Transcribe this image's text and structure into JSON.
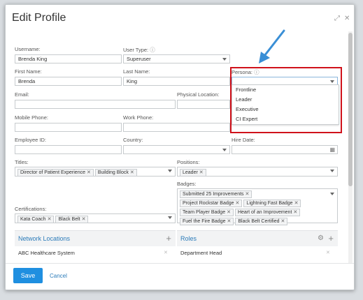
{
  "dialog": {
    "title": "Edit Profile"
  },
  "fields": {
    "username": {
      "label": "Username:",
      "value": "Brenda King"
    },
    "user_type": {
      "label": "User Type:",
      "value": "Superuser"
    },
    "first_name": {
      "label": "First Name:",
      "value": "Brenda"
    },
    "last_name": {
      "label": "Last Name:",
      "value": "King"
    },
    "persona": {
      "label": "Persona:",
      "value": ""
    },
    "email": {
      "label": "Email:",
      "value": ""
    },
    "physical_location": {
      "label": "Physical Location:",
      "value": ""
    },
    "mobile_phone": {
      "label": "Mobile Phone:",
      "value": ""
    },
    "work_phone": {
      "label": "Work Phone:",
      "value": ""
    },
    "employee_id": {
      "label": "Employee ID:",
      "value": ""
    },
    "country": {
      "label": "Country:",
      "value": ""
    },
    "hire_date": {
      "label": "Hire Date:",
      "value": ""
    },
    "titles": {
      "label": "Titles:"
    },
    "positions": {
      "label": "Positions:"
    },
    "badges": {
      "label": "Badges:"
    },
    "certifications": {
      "label": "Certifications:"
    }
  },
  "persona_options": [
    "Frontline",
    "Leader",
    "Executive",
    "CI Expert"
  ],
  "titles_chips": [
    "Director of Patient Experience",
    "Building Block"
  ],
  "positions_chips": [
    "Leader"
  ],
  "badges_chips": [
    "Submitted 25 Improvements",
    "Project Rockstar Badge",
    "Lightning Fast Badge",
    "Team Player Badge",
    "Heart of an Improvement",
    "Fuel the Fire Badge",
    "Black Belt Certified"
  ],
  "certifications_chips": [
    "Kata Coach",
    "Black Belt"
  ],
  "network_locations": {
    "title": "Network Locations",
    "items": [
      "ABC Healthcare System"
    ]
  },
  "roles": {
    "title": "Roles",
    "items": [
      "Department Head"
    ]
  },
  "footer": {
    "save": "Save",
    "cancel": "Cancel"
  },
  "glyphs": {
    "info": "ⓘ",
    "remove": "✕",
    "plus": "+",
    "gear": "⚙",
    "calendar": "▦",
    "expand": "⤢",
    "close": "✕"
  },
  "colors": {
    "accent": "#1f8fe0",
    "link": "#2b7bb9",
    "highlight": "#d0121b",
    "pointer": "#3a8fd6"
  }
}
